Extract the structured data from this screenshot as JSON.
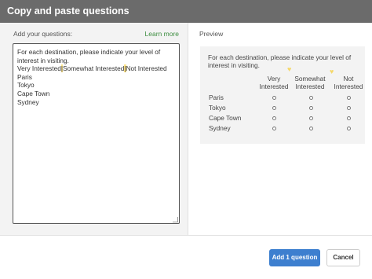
{
  "dialog": {
    "title": "Copy and paste questions"
  },
  "editor_panel": {
    "label": "Add your questions:",
    "learn_more": "Learn more",
    "lines": [
      "For each destination, please indicate your level of",
      "interest in visiting.",
      "Paris",
      "Tokyo",
      "Cape Town",
      "Sydney"
    ],
    "choices_line": {
      "choice_1": "Very Interested",
      "sep_1": "|",
      "choice_2": "Somewhat Interested",
      "sep_2": "|",
      "choice_3": "Not Interested"
    }
  },
  "preview": {
    "label": "Preview",
    "question": "For each destination, please indicate your level of interest in visiting.",
    "columns": [
      {
        "line1": "Very",
        "line2": "Interested"
      },
      {
        "line1": "Somewhat",
        "line2": "Interested"
      },
      {
        "line1": "Not",
        "line2": "Interested"
      }
    ],
    "rows": [
      "Paris",
      "Tokyo",
      "Cape Town",
      "Sydney"
    ]
  },
  "footer": {
    "primary_label": "Add 1 question",
    "secondary_label": "Cancel"
  },
  "colors": {
    "header_bg": "#6b6b6b",
    "accent_button": "#3d7fcf",
    "link": "#3e8e41",
    "highlight": "#ffe58a"
  }
}
